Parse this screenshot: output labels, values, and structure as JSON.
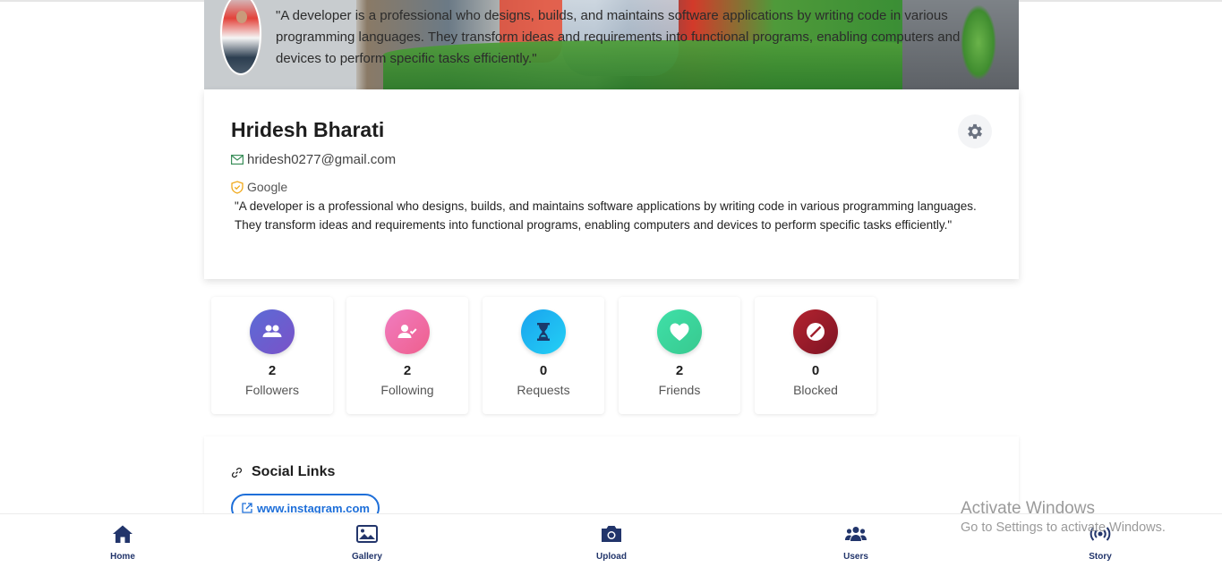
{
  "profile": {
    "banner_bio": "\"A developer is a professional who designs, builds, and maintains software applications by writing code in various programming languages. They transform ideas and requirements into functional programs, enabling computers and devices to perform specific tasks efficiently.\"",
    "name": "Hridesh Bharati",
    "email": "hridesh0277@gmail.com",
    "provider": "Google",
    "bio": "\"A developer is a professional who designs, builds, and maintains software applications by writing code in various programming languages. They transform ideas and requirements into functional programs, enabling computers and devices to perform specific tasks efficiently.\""
  },
  "stats": [
    {
      "value": "2",
      "label": "Followers",
      "icon": "users-icon",
      "color": "#6a63d1"
    },
    {
      "value": "2",
      "label": "Following",
      "icon": "user-check-icon",
      "color": "#e86aa6"
    },
    {
      "value": "0",
      "label": "Requests",
      "icon": "hourglass-icon",
      "color": "#1ea7f2"
    },
    {
      "value": "2",
      "label": "Friends",
      "icon": "heart-icon",
      "color": "#3fd3a1"
    },
    {
      "value": "0",
      "label": "Blocked",
      "icon": "ban-icon",
      "color": "#a01e2c"
    }
  ],
  "social": {
    "title": "Social Links",
    "links": [
      "www.instagram.com"
    ]
  },
  "nav": [
    {
      "label": "Home",
      "icon": "home-icon"
    },
    {
      "label": "Gallery",
      "icon": "gallery-icon"
    },
    {
      "label": "Upload",
      "icon": "camera-icon"
    },
    {
      "label": "Users",
      "icon": "users-icon"
    },
    {
      "label": "Story",
      "icon": "broadcast-icon"
    }
  ],
  "watermark": {
    "title": "Activate Windows",
    "subtitle": "Go to Settings to activate Windows."
  },
  "colors": {
    "accent": "#1e6fd9",
    "nav": "#22356b"
  }
}
